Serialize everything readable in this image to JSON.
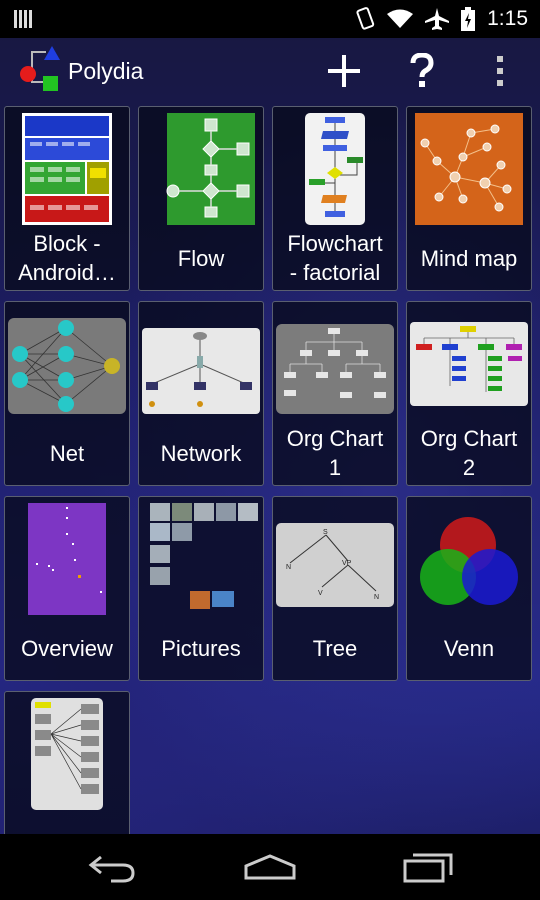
{
  "status_bar": {
    "time": "1:15",
    "icons": [
      "signal-bars-icon",
      "rotation-icon",
      "wifi-icon",
      "airplane-icon",
      "battery-icon"
    ]
  },
  "action_bar": {
    "app_title": "Polydia",
    "actions": [
      "add-icon",
      "help-icon",
      "overflow-menu-icon"
    ]
  },
  "diagrams": [
    {
      "label": "Block -\nAndroid…"
    },
    {
      "label": "Flow"
    },
    {
      "label": "Flowchart\n- factorial"
    },
    {
      "label": "Mind map"
    },
    {
      "label": "Net"
    },
    {
      "label": "Network"
    },
    {
      "label": "Org Chart\n1"
    },
    {
      "label": "Org Chart\n2"
    },
    {
      "label": "Overview"
    },
    {
      "label": "Pictures"
    },
    {
      "label": "Tree"
    },
    {
      "label": "Venn"
    },
    {
      "label": ""
    }
  ],
  "thumbnail_text": {
    "tree": {
      "s": "S",
      "n": "N",
      "vp": "VP",
      "v": "V",
      "n2": "N"
    }
  },
  "nav_bar": {
    "buttons": [
      "back-icon",
      "home-icon",
      "recent-apps-icon"
    ]
  },
  "colors": {
    "flow_green": "#2e9a2e",
    "mind_map_orange": "#d4641a",
    "net_cyan": "#27c8c8",
    "net_yellow": "#c8b427",
    "overview_purple": "#7d36c4",
    "venn_red": "#d01a1a",
    "venn_green": "#18b418",
    "venn_blue": "#1a1ad4"
  }
}
